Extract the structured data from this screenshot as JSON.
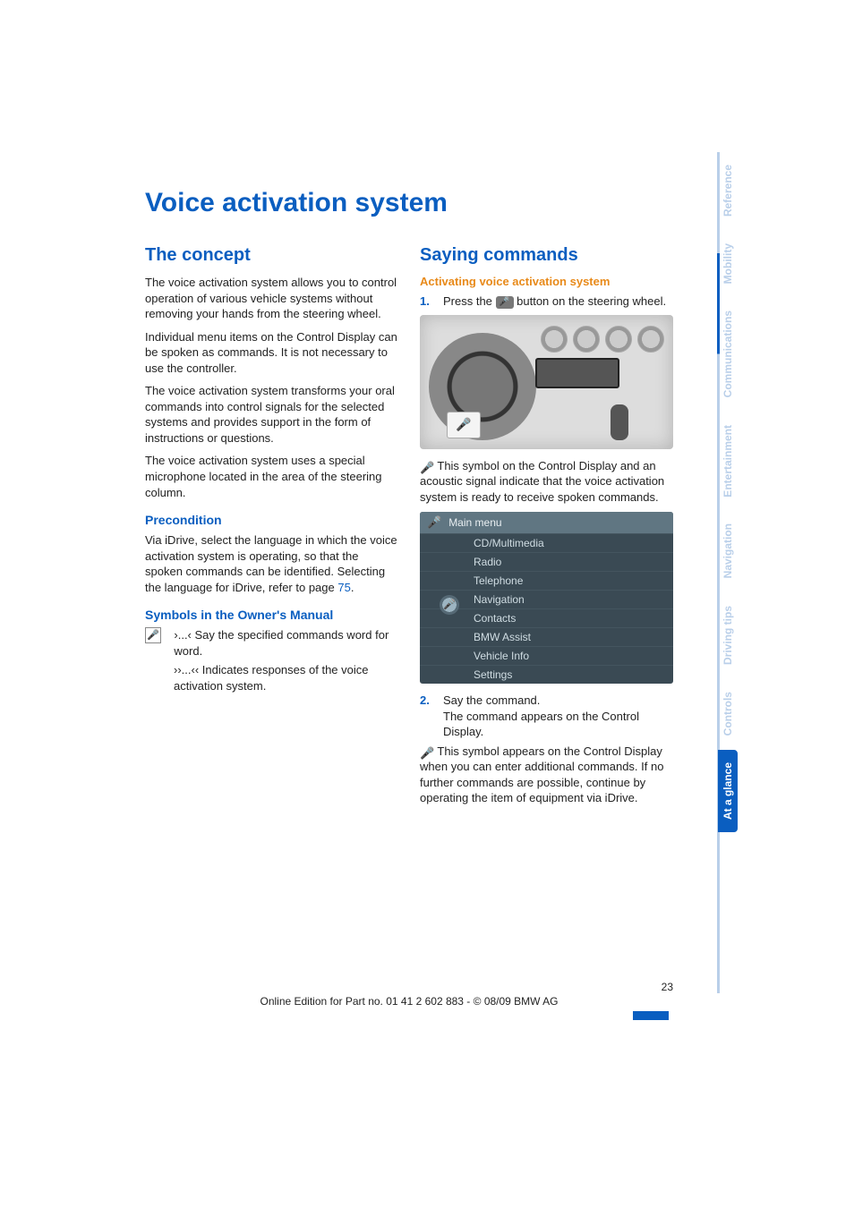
{
  "title": "Voice activation system",
  "left": {
    "h_concept": "The concept",
    "p1": "The voice activation system allows you to control operation of various vehicle systems without removing your hands from the steering wheel.",
    "p2": "Individual menu items on the Control Display can be spoken as commands. It is not necessary to use the controller.",
    "p3": "The voice activation system transforms your oral commands into control signals for the selected systems and provides support in the form of instructions or questions.",
    "p4": "The voice activation system uses a special microphone located in the area of the steering column.",
    "h_precond": "Precondition",
    "p5a": "Via iDrive, select the language in which the voice activation system is operating, so that the spoken commands can be identified. Selecting the language for iDrive, refer to page ",
    "p5_page": "75",
    "p5b": ".",
    "h_symbols": "Symbols in the Owner's Manual",
    "sym1_mark": "›...‹",
    "sym1_text": " Say the specified commands word for word.",
    "sym2_mark": "››...‹‹",
    "sym2_text": " Indicates responses of the voice activation system."
  },
  "right": {
    "h_say": "Saying commands",
    "h_activate": "Activating voice activation system",
    "step1_num": "1.",
    "step1a": "Press the ",
    "step1b": " button on the steering wheel.",
    "after_fig": " This symbol on the Control Display and an acoustic signal indicate that the voice activation system is ready to receive spoken commands.",
    "menu_title": "Main menu",
    "menu_items": [
      "CD/Multimedia",
      "Radio",
      "Telephone",
      "Navigation",
      "Contacts",
      "BMW Assist",
      "Vehicle Info",
      "Settings"
    ],
    "step2_num": "2.",
    "step2a": "Say the command.",
    "step2b": "The command appears on the Control Display.",
    "tail": " This symbol appears on the Control Display when you can enter additional commands. If no further commands are possible, continue by operating the item of equipment via iDrive."
  },
  "tabs": [
    "Reference",
    "Mobility",
    "Communications",
    "Entertainment",
    "Navigation",
    "Driving tips",
    "Controls",
    "At a glance"
  ],
  "active_tab": "At a glance",
  "footer": {
    "page": "23",
    "line": "Online Edition for Part no. 01 41 2 602 883 - © 08/09 BMW AG"
  }
}
